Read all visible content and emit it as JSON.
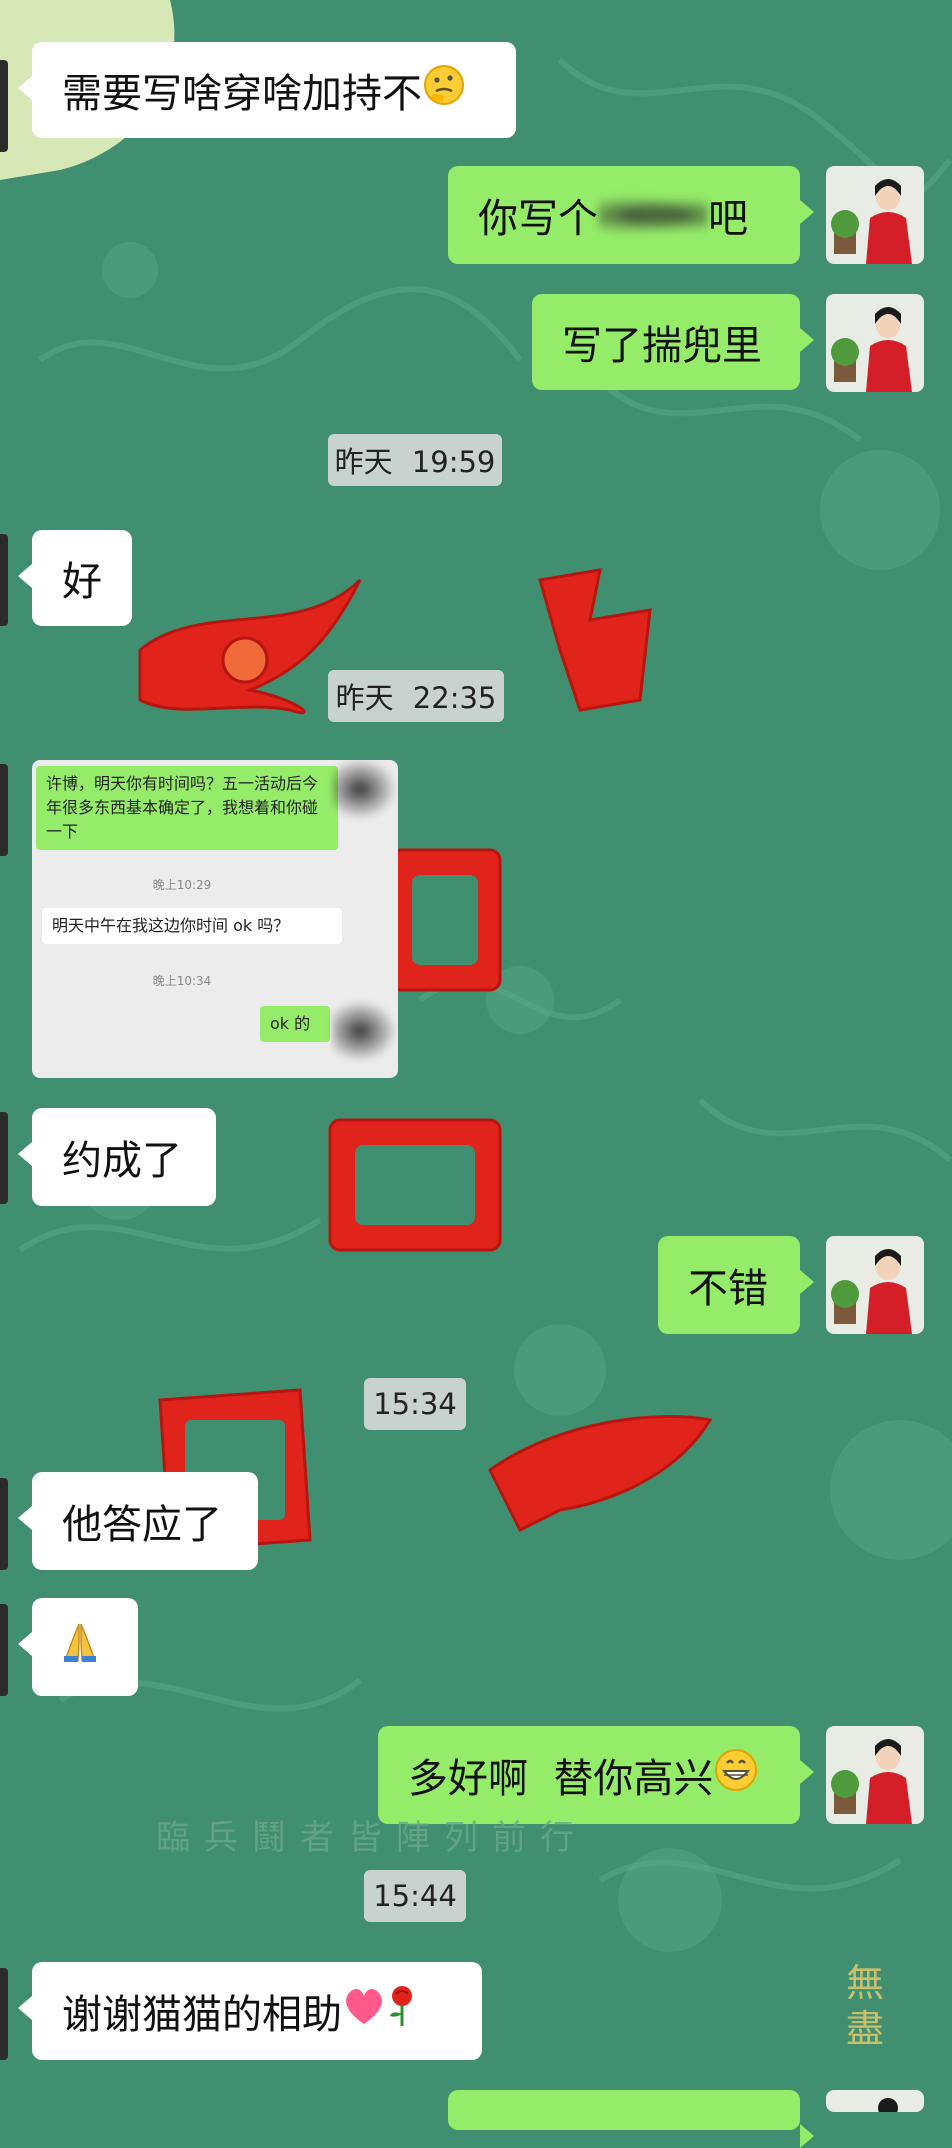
{
  "background": {
    "color": "#3f8f70",
    "caption": "臨兵鬪者皆陣列前行",
    "seal": "無盡"
  },
  "messages": [
    {
      "side": "in",
      "text": "需要写啥穿啥加持不",
      "emoji": "thinking-face"
    },
    {
      "side": "out",
      "text_before": "你写个",
      "redacted": true,
      "text_after": "吧"
    },
    {
      "side": "out",
      "text": "写了揣兜里"
    },
    {
      "timestamp": "昨天 19:59"
    },
    {
      "side": "in",
      "text": "好"
    },
    {
      "timestamp": "昨天 22:35"
    },
    {
      "side": "in",
      "type": "image"
    },
    {
      "side": "in",
      "text": "约成了"
    },
    {
      "side": "out",
      "text": "不错"
    },
    {
      "timestamp": "15:34"
    },
    {
      "side": "in",
      "text": "他答应了"
    },
    {
      "side": "in",
      "emoji_only": "folded-hands"
    },
    {
      "side": "out",
      "text": "多好啊  替你高兴",
      "emoji": "grinning-face"
    },
    {
      "timestamp": "15:44"
    },
    {
      "side": "in",
      "text": "谢谢猫猫的相助",
      "emoji": "heart, rose"
    }
  ],
  "bubbles": {
    "m1": "需要写啥穿啥加持不",
    "m2a": "你写个",
    "m2b": "吧",
    "m3": "写了揣兜里",
    "t1": "昨天 19:59",
    "m4": "好",
    "t2": "昨天 22:35",
    "m6": "约成了",
    "m7": "不错",
    "t3": "15:34",
    "m8": "他答应了",
    "m10": "多好啊  替你高兴",
    "t4": "15:44",
    "m11": "谢谢猫猫的相助"
  },
  "embedded_screenshot": {
    "msg1": "许博，明天你有时间吗？五一活动后今年很多东西基本确定了，我想着和你碰一下",
    "time1": "晚上10:29",
    "msg2": "明天中午在我这边你时间 ok 吗？",
    "time2": "晚上10:34",
    "msg3": "ok 的"
  },
  "colors": {
    "outgoing_bubble": "#95ec69",
    "incoming_bubble": "#ffffff",
    "timestamp_bg": "#dcdcdc",
    "seal_red": "#e0241b"
  }
}
